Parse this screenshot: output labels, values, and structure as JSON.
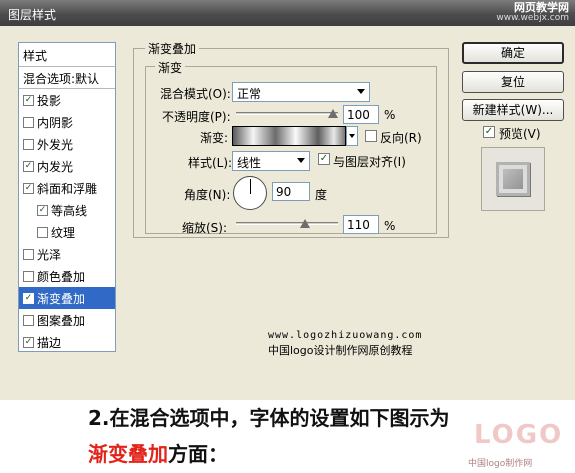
{
  "window": {
    "title": "图层样式",
    "watermark_line1": "网页教学网",
    "watermark_line2": "www.webjx.com"
  },
  "sidebar": {
    "header": "样式",
    "blend_options": "混合选项:默认",
    "items": [
      {
        "label": "投影",
        "checked": true,
        "selected": false,
        "indent": false
      },
      {
        "label": "内阴影",
        "checked": false,
        "selected": false,
        "indent": false
      },
      {
        "label": "外发光",
        "checked": false,
        "selected": false,
        "indent": false
      },
      {
        "label": "内发光",
        "checked": true,
        "selected": false,
        "indent": false
      },
      {
        "label": "斜面和浮雕",
        "checked": true,
        "selected": false,
        "indent": false
      },
      {
        "label": "等高线",
        "checked": true,
        "selected": false,
        "indent": true
      },
      {
        "label": "纹理",
        "checked": false,
        "selected": false,
        "indent": true
      },
      {
        "label": "光泽",
        "checked": false,
        "selected": false,
        "indent": false
      },
      {
        "label": "颜色叠加",
        "checked": false,
        "selected": false,
        "indent": false
      },
      {
        "label": "渐变叠加",
        "checked": true,
        "selected": true,
        "indent": false
      },
      {
        "label": "图案叠加",
        "checked": false,
        "selected": false,
        "indent": false
      },
      {
        "label": "描边",
        "checked": true,
        "selected": false,
        "indent": false
      }
    ]
  },
  "panel": {
    "outer_title": "渐变叠加",
    "inner_title": "渐变",
    "blend_mode_label": "混合模式(O):",
    "blend_mode_value": "正常",
    "opacity_label": "不透明度(P):",
    "opacity_value": "100",
    "opacity_unit": "%",
    "opacity_level": 1.0,
    "gradient_label": "渐变:",
    "reverse_label": "反向(R)",
    "reverse_checked": false,
    "style_label": "样式(L):",
    "style_value": "线性",
    "align_label": "与图层对齐(I)",
    "align_checked": true,
    "angle_label": "角度(N):",
    "angle_value": "90",
    "angle_unit": "度",
    "scale_label": "缩放(S):",
    "scale_value": "110",
    "scale_unit": "%"
  },
  "buttons": {
    "ok": "确定",
    "reset": "复位",
    "new_style": "新建样式(W)...",
    "preview_label": "预览(V)",
    "preview_checked": true
  },
  "credit": {
    "url": "www.logozhizuowang.com",
    "text": "中国logo设计制作网原创教程"
  },
  "caption": {
    "line1": "2.在混合选项中，字体的设置如下图示为",
    "line2_highlight": "渐变叠加",
    "line2_rest": "方面："
  },
  "logo": {
    "big": "LOGO",
    "small": "中国logo制作网"
  },
  "colors": {
    "selection": "#3169c6",
    "highlight_text": "#e2231a",
    "dialog_bg": "#ece9d8"
  }
}
